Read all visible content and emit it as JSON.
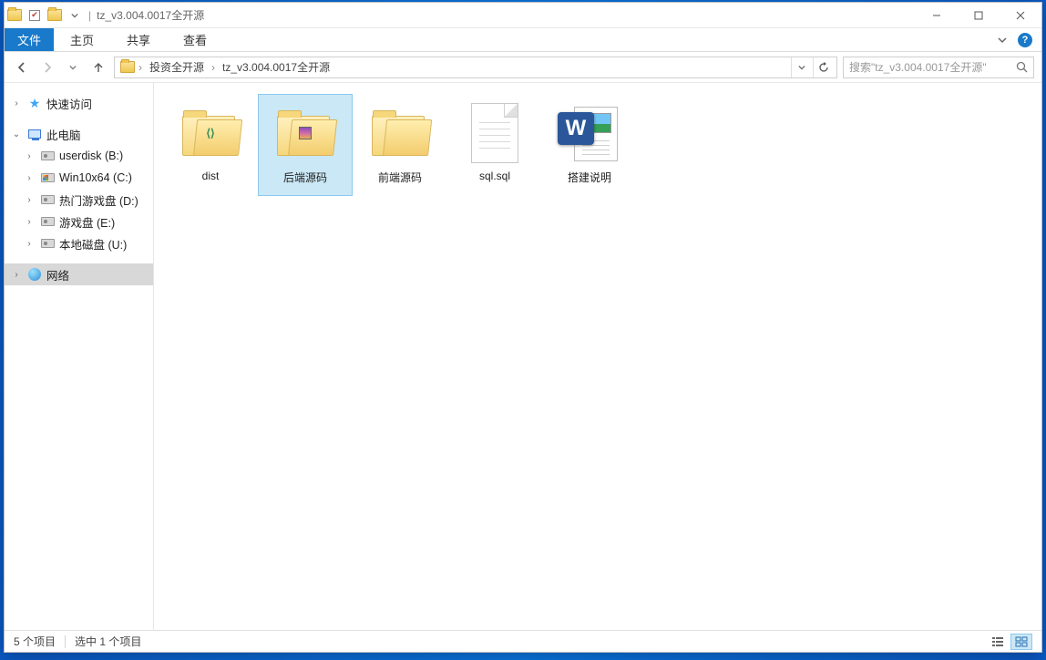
{
  "title": "tz_v3.004.0017全开源",
  "ribbon": {
    "file": "文件",
    "tabs": [
      "主页",
      "共享",
      "查看"
    ]
  },
  "breadcrumb": {
    "segments": [
      "投资全开源",
      "tz_v3.004.0017全开源"
    ]
  },
  "search": {
    "placeholder": "搜索\"tz_v3.004.0017全开源\""
  },
  "sidebar": {
    "quick_access": "快速访问",
    "this_pc": "此电脑",
    "drives": [
      {
        "label": "userdisk (B:)",
        "kind": "hdd"
      },
      {
        "label": "Win10x64 (C:)",
        "kind": "win"
      },
      {
        "label": "热门游戏盘 (D:)",
        "kind": "hdd"
      },
      {
        "label": "游戏盘 (E:)",
        "kind": "hdd"
      },
      {
        "label": "本地磁盘 (U:)",
        "kind": "hdd"
      }
    ],
    "network": "网络"
  },
  "items": [
    {
      "name": "dist",
      "type": "folder",
      "overlay": "code",
      "selected": false
    },
    {
      "name": "后端源码",
      "type": "folder",
      "overlay": "rar",
      "selected": true
    },
    {
      "name": "前端源码",
      "type": "folder",
      "overlay": "none",
      "selected": false
    },
    {
      "name": "sql.sql",
      "type": "file",
      "selected": false
    },
    {
      "name": "搭建说明",
      "type": "word",
      "selected": false
    }
  ],
  "status": {
    "count": "5 个项目",
    "selection": "选中 1 个项目"
  }
}
